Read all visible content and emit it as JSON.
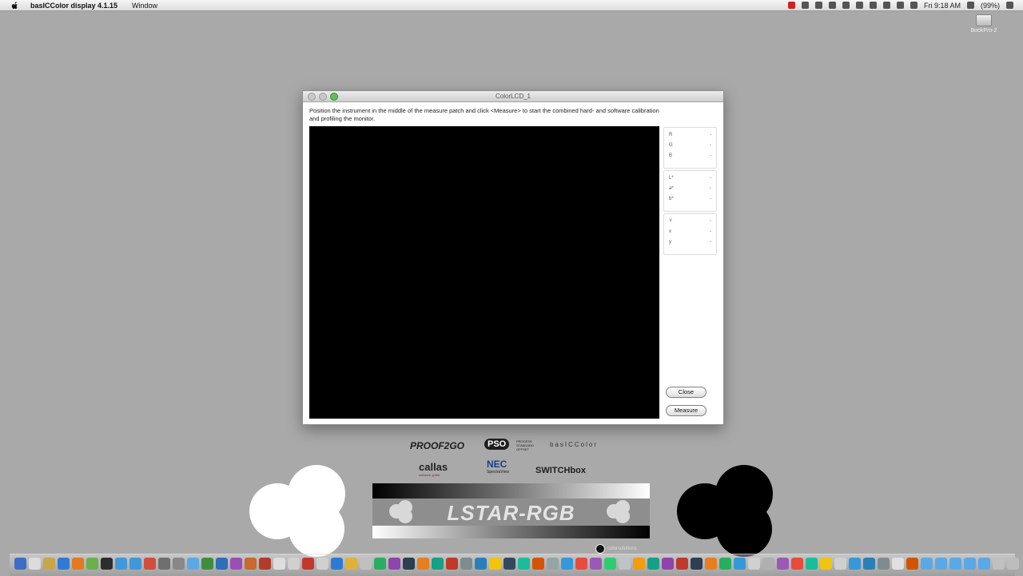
{
  "menubar": {
    "app_name": "basICColor display 4.1.15",
    "menus": [
      "Window"
    ],
    "clock": "Fri 9:18 AM",
    "battery": "(99%)"
  },
  "desktop": {
    "drive_label": "BookPro-2"
  },
  "dialog": {
    "title": "ColorLCD_1",
    "instruction": "Position the instrument in the middle of the measure patch and click <Measure> to start the combined hard- and software calibration and profiling the monitor.",
    "readouts": [
      [
        {
          "label": "R",
          "value": "-"
        },
        {
          "label": "G",
          "value": "-"
        },
        {
          "label": "B",
          "value": "-"
        }
      ],
      [
        {
          "label": "L*",
          "value": "-"
        },
        {
          "label": "a*",
          "value": "-"
        },
        {
          "label": "b*",
          "value": "-"
        }
      ],
      [
        {
          "label": "Y",
          "value": "-"
        },
        {
          "label": "x",
          "value": "-"
        },
        {
          "label": "y",
          "value": "-"
        }
      ]
    ],
    "buttons": {
      "close": "Close",
      "measure": "Measure"
    },
    "patch_color": "#000000"
  },
  "branding": {
    "proof2go": "PROOF2GO",
    "pso": "PSO",
    "pso_sub": "PROCESS STANDARD OFFSET",
    "basiccolor": "basICColor",
    "callas": "callas",
    "callas_sub": "software gmbh",
    "nec": "NEC",
    "nec_sub": "SpectraView",
    "switchbox": "SWITCHbox",
    "banner": "LSTAR-RGB",
    "credit": "colorsolutions"
  },
  "dock": {
    "colors": [
      "#3c6fc4",
      "#dcdcdc",
      "#c8a64a",
      "#2f7ad6",
      "#e27b1f",
      "#6ab04c",
      "#2d2d2d",
      "#3f98d8",
      "#3f98d8",
      "#d14d3c",
      "#6f6f6f",
      "#888888",
      "#5aa9e6",
      "#3f8c3f",
      "#2e6fba",
      "#9a4fb5",
      "#c8692d",
      "#b33b2a",
      "#dddddd",
      "#d0d0d0",
      "#c0392b",
      "#d0d0d0",
      "#2d7bd1",
      "#e0b13a",
      "#c0c0c0",
      "#27ae60",
      "#8e44ad",
      "#2c3e50",
      "#e67e22",
      "#16a085",
      "#c0392b",
      "#7f8c8d",
      "#2980b9",
      "#f1c40f",
      "#34495e",
      "#1abc9c",
      "#d35400",
      "#95a5a6",
      "#3498db",
      "#e74c3c",
      "#9b59b6",
      "#2ecc71",
      "#bdc3c7",
      "#f39c12",
      "#16a085",
      "#8e44ad",
      "#c0392b",
      "#2c3e50",
      "#e67e22",
      "#27ae60",
      "#3498db",
      "#d0d0d0",
      "#b0b0b0",
      "#9b59b6",
      "#e74c3c",
      "#1abc9c",
      "#f1c40f",
      "#d0d0d0",
      "#3498db",
      "#2980b9",
      "#7f8c8d",
      "#e0e0e0",
      "#d35400",
      "#5aa9e6",
      "#5aa9e6",
      "#5aa9e6",
      "#5aa9e6",
      "#5aa9e6",
      "#c0c0c0",
      "#bdbdbd"
    ]
  }
}
